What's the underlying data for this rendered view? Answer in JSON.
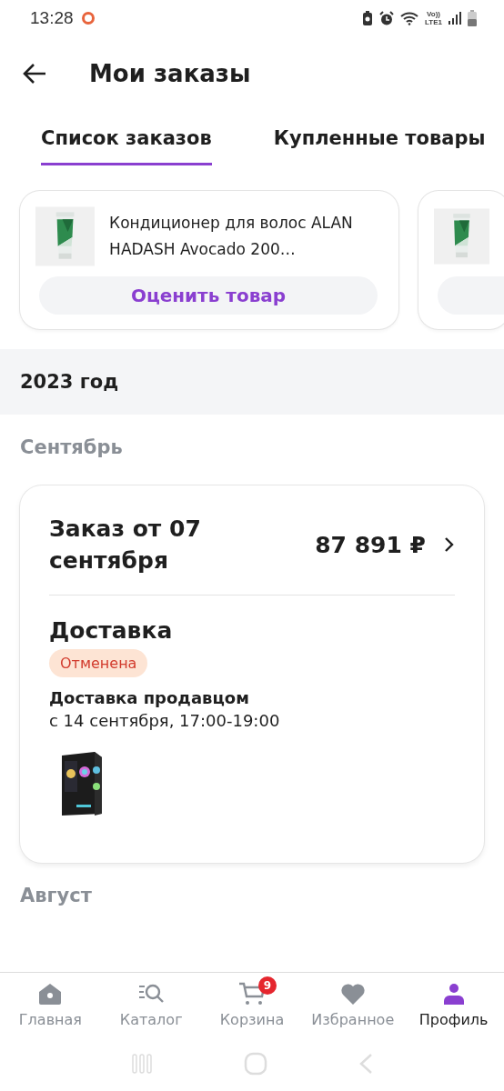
{
  "status_bar": {
    "time": "13:28",
    "lte_label": "Vo))\nLTE1"
  },
  "header": {
    "title": "Мои заказы"
  },
  "tabs": [
    {
      "label": "Список заказов",
      "selected": true
    },
    {
      "label": "Купленные товары",
      "selected": false
    }
  ],
  "products": [
    {
      "kind": "full",
      "name": "Кондиционер для волос ALAN HADASH Avocado 200…",
      "action": "Оценить товар"
    },
    {
      "kind": "partial"
    }
  ],
  "year": "2023 год",
  "months": [
    {
      "label": "Сентябрь",
      "orders": [
        {
          "title": "Заказ от 07 сентября",
          "price": "87 891 ₽",
          "section": "Доставка",
          "status": "Отменена",
          "method": "Доставка продавцом",
          "date": "с 14 сентября, 17:00-19:00"
        }
      ]
    },
    {
      "label": "Август"
    }
  ],
  "nav": [
    {
      "label": "Главная",
      "kind": "home",
      "selected": false
    },
    {
      "label": "Каталог",
      "kind": "catalog",
      "selected": false
    },
    {
      "label": "Корзина",
      "kind": "cart",
      "selected": false,
      "badge": "9"
    },
    {
      "label": "Избранное",
      "kind": "favorites",
      "selected": false
    },
    {
      "label": "Профиль",
      "kind": "profile",
      "selected": true
    }
  ]
}
